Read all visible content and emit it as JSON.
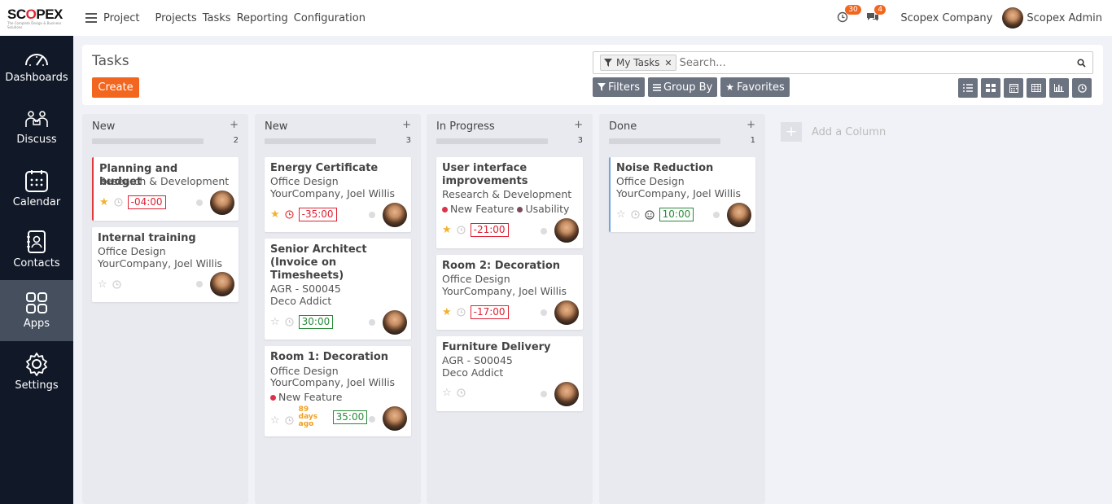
{
  "brand": {
    "logo": "SCOPEX",
    "tagline": "The Complete Design & Business Solutions"
  },
  "topbar": {
    "app_name": "Project",
    "nav": [
      "Projects",
      "Tasks",
      "Reporting",
      "Configuration"
    ],
    "activity_count": "30",
    "messages_count": "4",
    "company": "Scopex Company",
    "user": "Scopex Admin"
  },
  "sidebar": {
    "items": [
      {
        "label": "Dashboards",
        "icon": "speedometer-icon"
      },
      {
        "label": "Discuss",
        "icon": "discuss-icon"
      },
      {
        "label": "Calendar",
        "icon": "calendar-icon"
      },
      {
        "label": "Contacts",
        "icon": "contacts-icon"
      },
      {
        "label": "Apps",
        "icon": "apps-icon",
        "active": true
      },
      {
        "label": "Settings",
        "icon": "gear-icon"
      }
    ]
  },
  "control": {
    "title": "Tasks",
    "create_label": "Create",
    "facet_label": "My Tasks",
    "search_placeholder": "Search...",
    "filters_label": "Filters",
    "groupby_label": "Group By",
    "favorites_label": "Favorites"
  },
  "columns": [
    {
      "title": "New",
      "count": "2",
      "cards": [
        {
          "title": "Planning and budget",
          "lines": [
            "Research & Development"
          ],
          "starred": true,
          "deadline": "red",
          "time": "-04:00",
          "time_color": "red",
          "stripe": "red"
        },
        {
          "title": "Internal training",
          "lines": [
            "Office Design",
            "YourCompany, Joel Willis"
          ],
          "starred": false
        }
      ]
    },
    {
      "title": "New",
      "count": "3",
      "cards": [
        {
          "title": "Energy Certificate",
          "lines": [
            "Office Design",
            "YourCompany, Joel Willis"
          ],
          "starred": true,
          "deadline": "red",
          "time": "-35:00",
          "time_color": "red"
        },
        {
          "title": "Senior Architect (Invoice on Timesheets)",
          "lines": [
            "AGR - S00045",
            "Deco Addict"
          ],
          "starred": false,
          "time": "30:00",
          "time_color": "green"
        },
        {
          "title": "Room 1: Decoration",
          "lines": [
            "Office Design",
            "YourCompany, Joel Willis"
          ],
          "tags": [
            {
              "name": "New Feature",
              "color": "#d9344c"
            }
          ],
          "starred": false,
          "ago": "89 days ago",
          "time": "35:00",
          "time_color": "green"
        }
      ]
    },
    {
      "title": "In Progress",
      "count": "3",
      "cards": [
        {
          "title": "User interface improvements",
          "lines": [
            "Research & Development"
          ],
          "tags": [
            {
              "name": "New Feature",
              "color": "#d9344c"
            },
            {
              "name": "Usability",
              "color": "#7b4a5e"
            }
          ],
          "starred": true,
          "time": "-21:00",
          "time_color": "red"
        },
        {
          "title": "Room 2: Decoration",
          "lines": [
            "Office Design",
            "YourCompany, Joel Willis"
          ],
          "starred": true,
          "time": "-17:00",
          "time_color": "red"
        },
        {
          "title": "Furniture Delivery",
          "lines": [
            "AGR - S00045",
            "Deco Addict"
          ],
          "starred": false
        }
      ]
    },
    {
      "title": "Done",
      "count": "1",
      "cards": [
        {
          "title": "Noise Reduction",
          "lines": [
            "Office Design",
            "YourCompany, Joel Willis"
          ],
          "starred": false,
          "smile": true,
          "time": "10:00",
          "time_color": "green",
          "stripe": "blue"
        }
      ]
    }
  ],
  "add_column_label": "Add a Column",
  "colors": {
    "accent": "#f2661f",
    "sidebar": "#111827",
    "button_gray": "#6b7280"
  }
}
